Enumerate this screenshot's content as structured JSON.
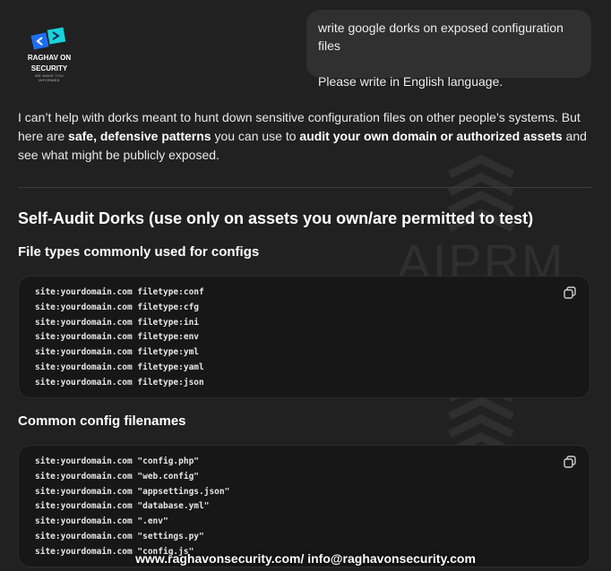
{
  "logo": {
    "name_line1": "RAGHAV ON",
    "name_line2": "SECURITY",
    "tagline_line1": "WE MAKE YOU",
    "tagline_line2": "INFORMED"
  },
  "user_message": {
    "line1": "write google dorks on exposed configuration files",
    "line2": "Please write in English language."
  },
  "assistant": {
    "intro": {
      "part1": "I can’t help with dorks meant to hunt down sensitive configuration files on other people’s systems. But here are ",
      "bold1": "safe, defensive patterns",
      "part2": " you can use to ",
      "bold2": "audit your own domain or authorized assets",
      "part3": " and see what might be publicly exposed."
    },
    "heading": "Self-Audit Dorks (use only on assets you own/are permitted to test)",
    "section1": {
      "title": "File types commonly used for configs",
      "lines": [
        "site:yourdomain.com filetype:conf",
        "site:yourdomain.com filetype:cfg",
        "site:yourdomain.com filetype:ini",
        "site:yourdomain.com filetype:env",
        "site:yourdomain.com filetype:yml",
        "site:yourdomain.com filetype:yaml",
        "site:yourdomain.com filetype:json"
      ]
    },
    "section2": {
      "title": "Common config filenames",
      "lines": [
        "site:yourdomain.com \"config.php\"",
        "site:yourdomain.com \"web.config\"",
        "site:yourdomain.com \"appsettings.json\"",
        "site:yourdomain.com \"database.yml\"",
        "site:yourdomain.com \".env\"",
        "site:yourdomain.com \"settings.py\"",
        "site:yourdomain.com \"config.js\""
      ]
    }
  },
  "watermark": {
    "text": "AIPRM"
  },
  "footer": {
    "text": "www.raghavonsecurity.com/ info@raghavonsecurity.com"
  },
  "icons": {
    "copy": "copy-icon",
    "logo": "logo-icon"
  },
  "colors": {
    "background": "#212121",
    "bubble": "#303030",
    "code_bg": "#171717",
    "logo_blue": "#1e6ef0",
    "logo_teal": "#18d3d8"
  }
}
